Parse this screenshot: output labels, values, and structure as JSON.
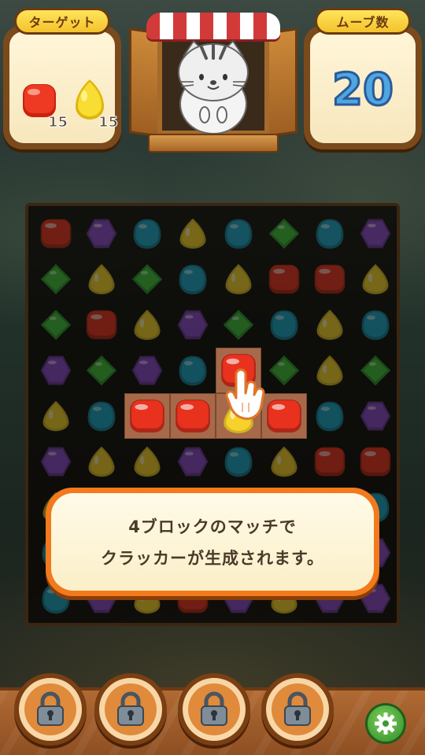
{
  "target_panel": {
    "title": "ターゲット",
    "items": [
      {
        "icon": "red-jelly-icon",
        "count": "15"
      },
      {
        "icon": "yellow-drop-icon",
        "count": "15"
      }
    ]
  },
  "moves_panel": {
    "title": "ムーブ数",
    "value": "20"
  },
  "tutorial": {
    "line1": "4ブロックのマッチで",
    "line2": "クラッカーが生成されます。"
  },
  "board": {
    "rows": [
      [
        "red",
        "purple",
        "teal",
        "yellow",
        "teal",
        "green",
        "teal",
        "purple"
      ],
      [
        "green",
        "yellow",
        "green",
        "teal",
        "yellow",
        "red",
        "red",
        "yellow"
      ],
      [
        "green",
        "red",
        "yellow",
        "purple",
        "green",
        "teal",
        "yellow",
        "teal"
      ],
      [
        "purple",
        "green",
        "purple",
        "teal",
        "red",
        "green",
        "yellow",
        "green"
      ],
      [
        "yellow",
        "teal",
        "red",
        "red",
        "yellow",
        "red",
        "teal",
        "purple"
      ],
      [
        "purple",
        "yellow",
        "yellow",
        "purple",
        "teal",
        "yellow",
        "red",
        "red"
      ],
      [
        "yellow",
        "purple",
        "teal",
        "green",
        "purple",
        "teal",
        "yellow",
        "teal"
      ],
      [
        "teal",
        "purple",
        "teal",
        "green",
        "purple",
        "red",
        "teal",
        "purple"
      ],
      [
        "teal",
        "purple",
        "yellow",
        "red",
        "purple",
        "yellow",
        "purple",
        "purple"
      ]
    ],
    "highlight": [
      {
        "col": 2,
        "row": 4,
        "color": "red"
      },
      {
        "col": 3,
        "row": 4,
        "color": "red"
      },
      {
        "col": 4,
        "row": 4,
        "color": "yellow"
      },
      {
        "col": 5,
        "row": 4,
        "color": "red"
      },
      {
        "col": 4,
        "row": 3,
        "color": "red"
      }
    ]
  },
  "colors": {
    "red": "#e8321e",
    "yellow": "#f6d22a",
    "teal": "#1aa5c4",
    "green": "#3fc03a",
    "purple": "#8a4ac8"
  },
  "boosters": [
    {
      "icon": "lock-icon",
      "state": "locked"
    },
    {
      "icon": "lock-icon",
      "state": "locked"
    },
    {
      "icon": "lock-icon",
      "state": "locked"
    },
    {
      "icon": "lock-icon",
      "state": "locked"
    }
  ],
  "settings_icon": "gear-icon"
}
